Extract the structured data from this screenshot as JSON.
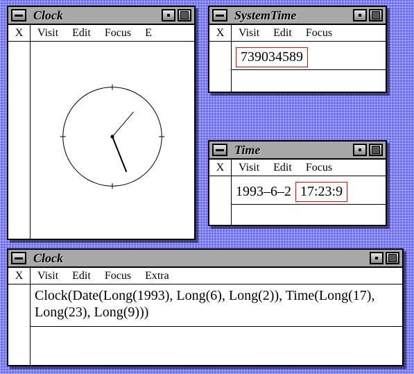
{
  "menus": {
    "x": "X",
    "visit": "Visit",
    "edit": "Edit",
    "focus": "Focus",
    "extra": "Extra",
    "extra_initial": "E"
  },
  "windows": {
    "clock1": {
      "title": "Clock"
    },
    "systime": {
      "title": "SystemTime",
      "value": "739034589"
    },
    "time": {
      "title": "Time",
      "date": "1993–6–2",
      "time": "17:23:9"
    },
    "clock2": {
      "title": "Clock",
      "expr": "Clock(Date(Long(1993), Long(6), Long(2)), Time(Long(17), Long(23), Long(9)))"
    }
  },
  "clock": {
    "hour": 17,
    "minute": 23,
    "second": 9
  }
}
